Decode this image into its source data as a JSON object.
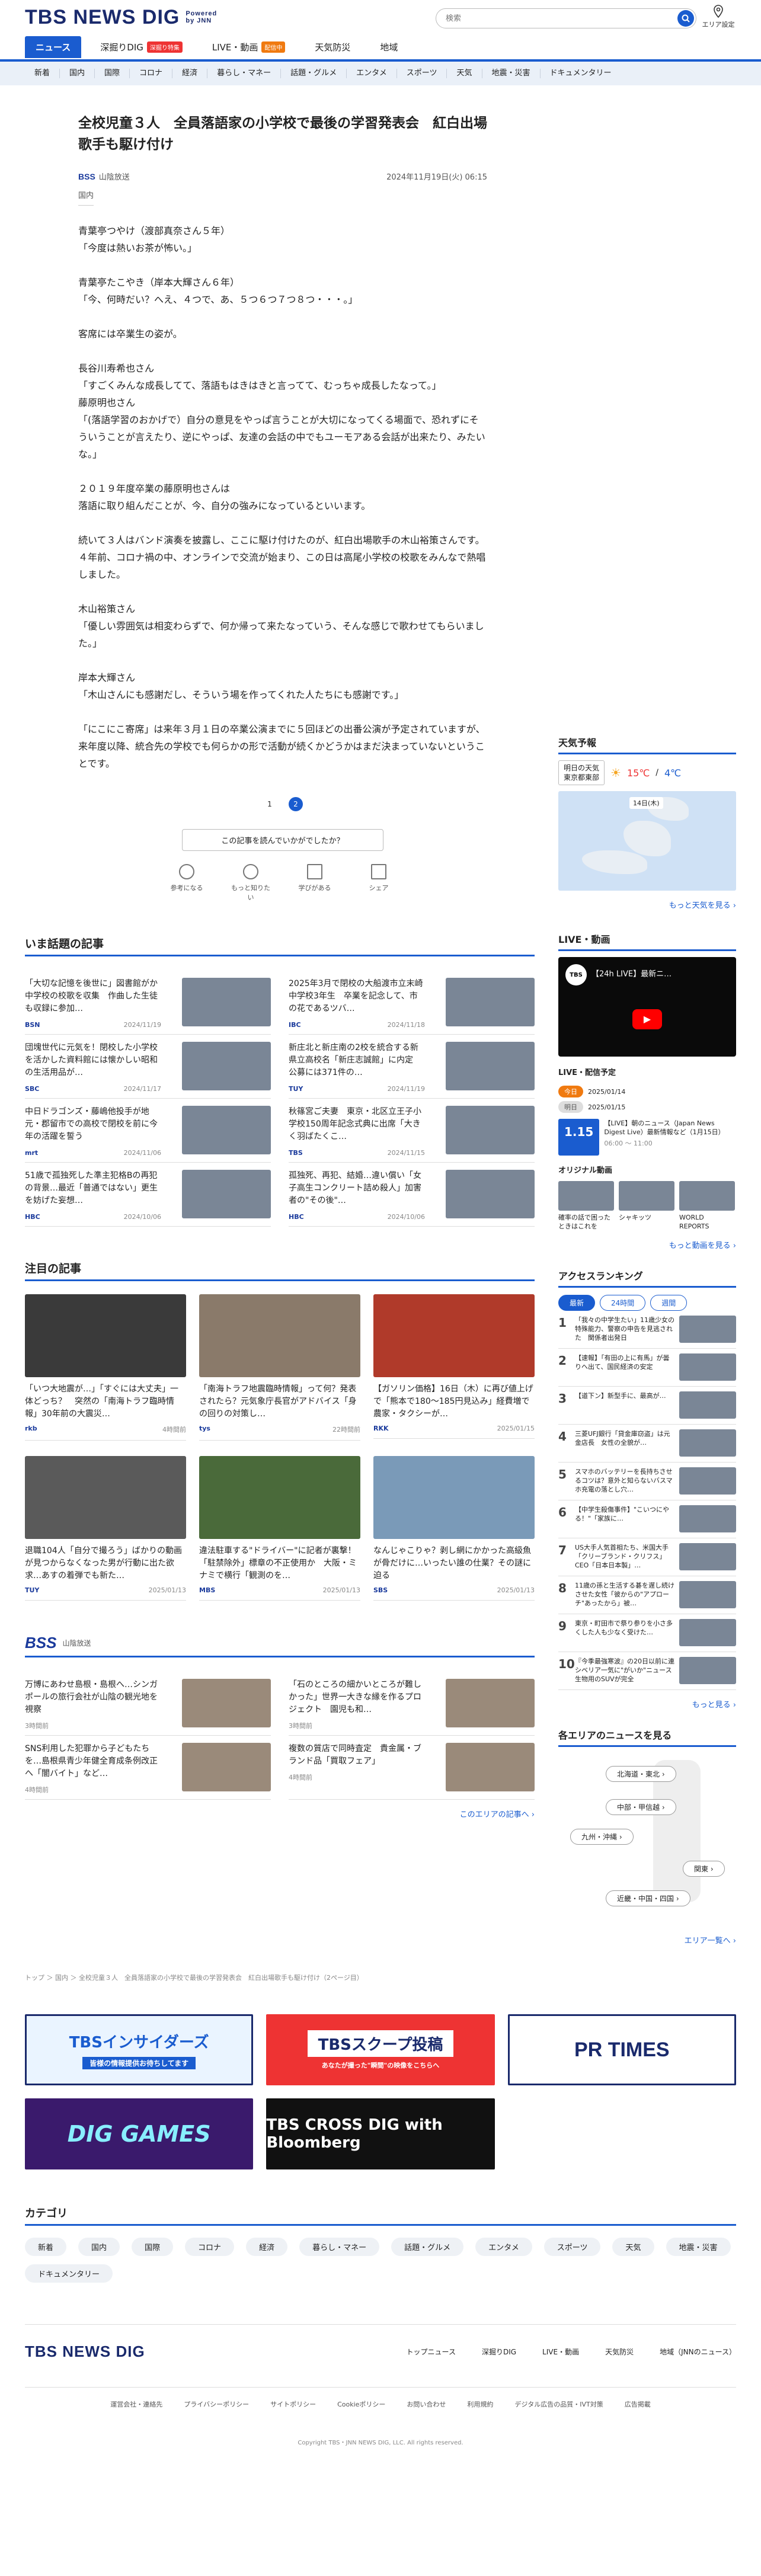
{
  "header": {
    "logo": "TBS NEWS DIG",
    "powered": "Powered by JNN",
    "search_placeholder": "検索",
    "area_setting": "エリア設定"
  },
  "mainnav": [
    {
      "label": "ニュース",
      "tag": ""
    },
    {
      "label": "深掘りDIG",
      "tag": "深掘り特集"
    },
    {
      "label": "LIVE・動画",
      "tag": "配信中"
    },
    {
      "label": "天気防災",
      "tag": ""
    },
    {
      "label": "地域",
      "tag": ""
    }
  ],
  "categories_top": [
    "新着",
    "国内",
    "国際",
    "コロナ",
    "経済",
    "暮らし・マネー",
    "話題・グルメ",
    "エンタメ",
    "スポーツ",
    "天気",
    "地震・災害",
    "ドキュメンタリー"
  ],
  "article": {
    "title": "全校児童３人　全員落語家の小学校で最後の学習発表会　紅白出場歌手も駆け付け",
    "source": "山陰放送",
    "datetime": "2024年11月19日(火) 06:15",
    "category": "国内",
    "paragraphs": [
      "青葉亭つやけ（渡部真奈さん５年）\n「今度は熱いお茶が怖い。」",
      "青葉亭たこやき（岸本大輝さん６年）\n「今、何時だい？へえ、４つで、あ、５つ６つ７つ８つ・・・。」",
      "客席には卒業生の姿が。",
      "長谷川寿希也さん\n「すごくみんな成長してて、落語もはきはきと言ってて、むっちゃ成長したなって。」\n藤原明也さん\n「(落語学習のおかげで）自分の意見をやっぱ言うことが大切になってくる場面で、恐れずにそういうことが言えたり、逆にやっぱ、友達の会話の中でもユーモアある会話が出来たり、みたいな。」",
      "２０１９年度卒業の藤原明也さんは\n落語に取り組んだことが、今、自分の強みになっているといいます。",
      "続いて３人はバンド演奏を披露し、ここに駆け付けたのが、紅白出場歌手の木山裕策さんです。\n４年前、コロナ禍の中、オンラインで交流が始まり、この日は高尾小学校の校歌をみんなで熱唱しました。",
      "木山裕策さん\n「優しい雰囲気は相変わらずで、何か帰って来たなっていう、そんな感じで歌わせてもらいました。」",
      "岸本大輝さん\n「木山さんにも感謝だし、そういう場を作ってくれた人たちにも感謝です。」",
      "「にこにこ寄席」は来年３月１日の卒業公演までに５回ほどの出番公演が予定されていますが、来年度以降、統合先の学校でも何らかの形で活動が続くかどうかはまだ決まっていないということです。"
    ],
    "pages": [
      "1",
      "2"
    ],
    "feedback": "この記事を読んでいかがでしたか？",
    "reactions": [
      "参考になる",
      "もっと知りたい",
      "学びがある",
      "シェア"
    ]
  },
  "trending": {
    "title": "いま話題の記事",
    "items": [
      {
        "text": "「大切な記憶を後世に」図書館がか中学校の校歌を収集　作曲した生徒も収録に参加…",
        "src": "BSN",
        "date": "2024/11/19"
      },
      {
        "text": "2025年3月で閉校の大船渡市立末崎中学校3年生　卒業を記念して、市の花であるツバ…",
        "src": "IBC",
        "date": "2024/11/18"
      },
      {
        "text": "団塊世代に元気を！閉校した小学校を活かした資料館には懐かしい昭和の生活用品が…",
        "src": "SBC",
        "date": "2024/11/17"
      },
      {
        "text": "新庄北と新庄南の2校を統合する新県立高校名「新庄志誠館」に内定　公募には371件の…",
        "src": "TUY",
        "date": "2024/11/19"
      },
      {
        "text": "中日ドラゴンズ・藤嶋他投手が地元・郡留市での高校で閉校を前に今年の活躍を誓う",
        "src": "mrt",
        "date": "2024/11/06"
      },
      {
        "text": "秋篠宮ご夫妻　東京・北区立王子小学校150周年記念式典に出席「大きく羽ばたくこ…",
        "src": "TBS",
        "date": "2024/11/15"
      },
      {
        "text": "51歳で孤独死した準主犯格Bの再犯の背景…最近「普通ではない」更生を妨げた妄想…",
        "src": "HBC",
        "date": "2024/10/06"
      },
      {
        "text": "孤独死、再犯、結婚…違い償い「女子高生コンクリート詰め殺人」加害者の\"その後\"…",
        "src": "HBC",
        "date": "2024/10/06"
      }
    ]
  },
  "featured": {
    "title": "注目の記事",
    "items": [
      {
        "text": "「いつ大地震が…」「すぐには大丈夫」一体どっち？　突然の「南海トラフ臨時情報」30年前の大震災…",
        "src": "rkb",
        "date": "4時間前"
      },
      {
        "text": "「南海トラフ地震臨時情報」って何？発表されたら？元気象庁長官がアドバイス「身の回りの対策し…",
        "src": "tys",
        "date": "22時間前"
      },
      {
        "text": "【ガソリン価格】16日（木）に再び値上げで「熊本で180～185円見込み」経費増で農家・タクシーが…",
        "src": "RKK",
        "date": "2025/01/15"
      },
      {
        "text": "退職104人「自分で撮ろう」ばかりの動画が見つからなくなった男が行動に出た欲求…あすの着弾でも新た…",
        "src": "TUY",
        "date": "2025/01/13"
      },
      {
        "text": "違法駐車する\"ドライバー\"に記者が裏撃！「駐禁除外」標章の不正使用か　大阪・ミナミで横行「観測のを…",
        "src": "MBS",
        "date": "2025/01/13"
      },
      {
        "text": "なんじゃこりゃ？剥し網にかかった高級魚が骨だけに…いったい誰の仕業？その謎に迫る",
        "src": "SBS",
        "date": "2025/01/13"
      }
    ]
  },
  "regional": {
    "brand": "BSS",
    "station": "山陰放送",
    "items": [
      {
        "text": "万博にあわせ島根・島根へ…シンガポールの旅行会社が山陰の観光地を視察",
        "date": "3時間前"
      },
      {
        "text": "「石のところの細かいところが難しかった」世界一大きな縁を作るプロジェクト　園児も和…",
        "date": "3時間前"
      },
      {
        "text": "SNS利用した犯罪から子どもたちを…島根県青少年健全育成条例改正へ「闇バイト」など…",
        "date": "4時間前"
      },
      {
        "text": "複数の質店で同時査定　貴金属・ブランド品「買取フェア」",
        "date": "4時間前"
      }
    ],
    "more": "このエリアの記事へ ›"
  },
  "sidebar": {
    "weather": {
      "title": "天気予報",
      "tomorrow": "明日の天気",
      "area": "東京都東部",
      "high": "15℃",
      "low": "4℃",
      "date_label": "14日(木)",
      "more": "もっと天気を見る ›"
    },
    "live": {
      "title": "LIVE・動画",
      "video_title": "【24h LIVE】最新ニ…",
      "sched_title": "LIVE・配信予定",
      "tab1": "今日",
      "tab1_date": "2025/01/14",
      "tab2": "明日",
      "tab2_date": "2025/01/15",
      "sched_time": "1.15",
      "sched_text": "【LIVE】朝のニュース（Japan News Digest Live）最新情報など（1月15日）",
      "sched_clock": "06:00 ～ 11:00",
      "orig_title": "オリジナル動画",
      "orig": [
        "確率の話で困ったときはこれを",
        "シャキッツ",
        "WORLD REPORTS"
      ],
      "more": "もっと動画を見る ›"
    },
    "ranking": {
      "title": "アクセスランキング",
      "tabs": [
        "最新",
        "24時間",
        "週間"
      ],
      "items": [
        "「我々の中学生たい」11歳少女の特殊能力、警察の申告を見逃された　関係者出発日",
        "【速報】「有田の上に有馬」が曇りへ出て、国民経済の安定",
        "【道下ン】新型手に、最高が…",
        "三菱UFJ銀行「貸金庫窃盗」は元金店長　女性の全貌が…",
        "スマホのバッテリーを長持ちさせるコツは？意外と知らないバスマホ充電の落とし穴…",
        "【中学生殺傷事件】\"こいつにやる！\"「家族に…",
        "US大手人気首相たち、米国大手「クリーブランド・クリフス」CEO「日本日本製」…",
        "11歳の孫と生活する碁を遅し続けさせた女性「彼からの\"アプローチ\"あったから」被…",
        "東京・町田市で祭り参りを小さ多くした人も少なく受けた…",
        "『今季最強寒波』の20日以前に連シベリア一気に\"がいか\"ニュース生物用のSUVが完全"
      ],
      "more": "もっと見る ›"
    },
    "area": {
      "title": "各エリアのニュースを見る",
      "buttons": [
        "北海道・東北 ›",
        "中部・甲信越 ›",
        "九州・沖縄 ›",
        "関東 ›",
        "近畿・中国・四国 ›"
      ],
      "more": "エリア一覧へ ›"
    }
  },
  "breadcrumb": "トップ ＞ 国内 ＞ 全校児童３人　全員落語家の小学校で最後の学習発表会　紅白出場歌手も駆け付け（2ページ目）",
  "banners": [
    "TBSインサイダーズ",
    "TBSスクープ投稿",
    "PR TIMES",
    "DIG GAMES",
    "TBS CROSS DIG with Bloomberg"
  ],
  "banner_sub": [
    "皆様の情報提供お待ちしてます",
    "あなたが撮った\"瞬間\"の映像をこちらへ"
  ],
  "category_section": {
    "title": "カテゴリ",
    "items": [
      "新着",
      "国内",
      "国際",
      "コロナ",
      "経済",
      "暮らし・マネー",
      "話題・グルメ",
      "エンタメ",
      "スポーツ",
      "天気",
      "地震・災害",
      "ドキュメンタリー"
    ]
  },
  "footer": {
    "links": [
      "トップニュース",
      "深掘りDIG",
      "LIVE・動画",
      "天気防災",
      "地域（JNNのニュース）"
    ],
    "sub": [
      "運営会社・連絡先",
      "プライバシーポリシー",
      "サイトポリシー",
      "Cookieポリシー",
      "お問い合わせ",
      "利用規約",
      "デジタル広告の品質・IVT対策",
      "広告掲載"
    ],
    "copyright": "Copyright TBS・JNN NEWS DIG, LLC. All rights reserved."
  },
  "colors": {
    "accent": "#1a5ccf",
    "brand": "#1a2a6c"
  }
}
